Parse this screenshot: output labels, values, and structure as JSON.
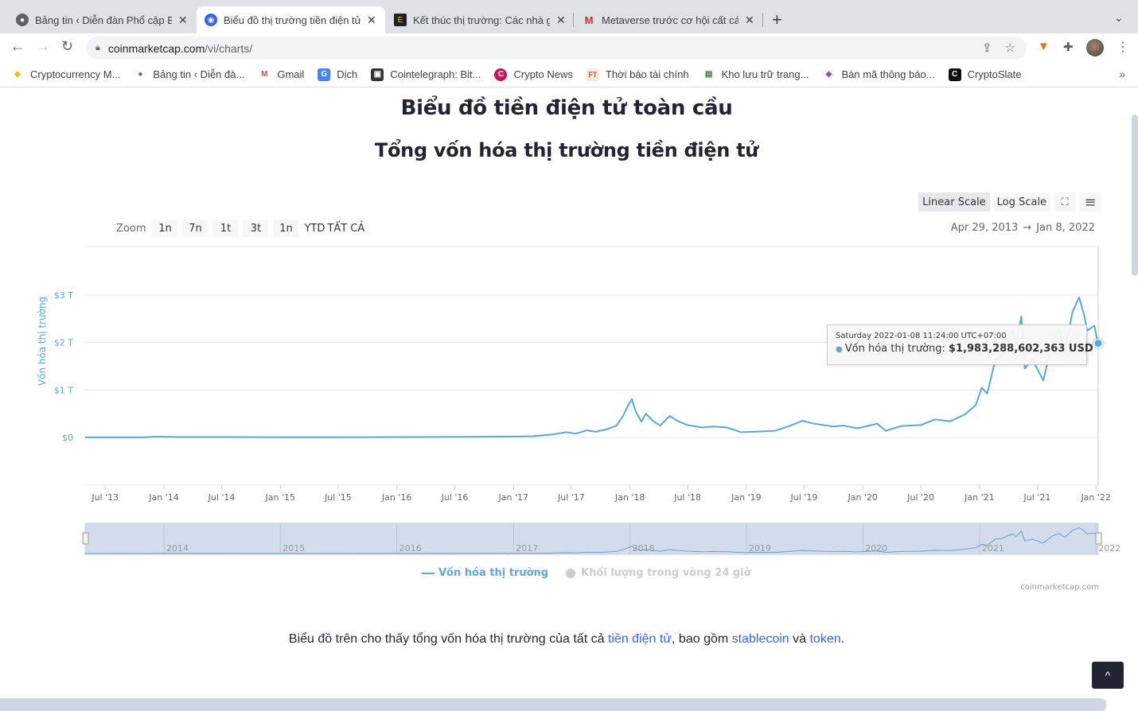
{
  "browser": {
    "tabs": [
      {
        "label": "Bảng tin ‹ Diễn đàn Phổ cập Bl",
        "icon": "globe-icon",
        "active": false
      },
      {
        "label": "Biểu đồ thị trường tiền điện tử t",
        "icon": "coinmarketcap-icon",
        "active": true
      },
      {
        "label": "Kết thúc thị trường: Các nhà gi",
        "icon": "site-icon",
        "active": false
      },
      {
        "label": "Metaverse trước cơ hội cất cán",
        "icon": "gmail-like-icon",
        "active": false
      }
    ],
    "close_glyph": "✕",
    "new_tab_glyph": "+",
    "url_domain": "coinmarketcap.com",
    "url_path": "/vi/charts/",
    "bookmarks": [
      {
        "label": "Cryptocurrency M...",
        "icon": "binance-icon",
        "glyph": "◆",
        "color": "#f0b90b"
      },
      {
        "label": "Bảng tin ‹ Diễn đà...",
        "icon": "globe-icon",
        "glyph": "●",
        "color": "#5f6368"
      },
      {
        "label": "Gmail",
        "icon": "gmail-icon",
        "glyph": "M",
        "color": "#ea4335"
      },
      {
        "label": "Dịch",
        "icon": "translate-icon",
        "glyph": "G",
        "color": "#4285f4"
      },
      {
        "label": "Cointelegraph: Bit...",
        "icon": "cointelegraph-icon",
        "glyph": "▣",
        "color": "#333333"
      },
      {
        "label": "Crypto News",
        "icon": "crypto-news-icon",
        "glyph": "C",
        "color": "#c2185b"
      },
      {
        "label": "Thời báo tài chính",
        "icon": "ft-icon",
        "glyph": "FT",
        "color": "#b05a3c"
      },
      {
        "label": "Kho lưu trữ trang...",
        "icon": "archive-icon",
        "glyph": "▤",
        "color": "#2e7d32"
      },
      {
        "label": "Bán mã thông báo...",
        "icon": "fox-icon",
        "glyph": "◈",
        "color": "#8e44ad"
      },
      {
        "label": "CryptoSlate",
        "icon": "cryptoslate-icon",
        "glyph": "C",
        "color": "#111111"
      }
    ],
    "more_glyph": "»"
  },
  "page": {
    "title": "Biểu đồ tiền điện tử toàn cầu",
    "subtitle": "Tổng vốn hóa thị trường tiền điện tử",
    "scale_buttons": [
      {
        "label": "Linear Scale",
        "active": true
      },
      {
        "label": "Log Scale",
        "active": false
      }
    ],
    "zoom_label": "Zoom",
    "zoom_buttons": [
      "1n",
      "7n",
      "1t",
      "3t",
      "1n",
      "YTD",
      "TẤT CẢ"
    ],
    "range_from": "Apr 29, 2013",
    "range_arrow": "→",
    "range_to": "Jan 8, 2022",
    "tooltip": {
      "date": "Saturday 2022-01-08 11:24:00 UTC+07:00",
      "series": "Vốn hóa thị trường:",
      "value": "$1,983,288,602,363 USD"
    },
    "legend": [
      {
        "label": "Vốn hóa thị trường",
        "color": "#5ba7d8",
        "enabled": true
      },
      {
        "label": "Khối lượng trong vòng 24 giờ",
        "color": "#cccccc",
        "enabled": false
      }
    ],
    "credit": "coinmarketcap.com",
    "description": {
      "before": "Biểu đồ trên cho thấy tổng vốn hóa thị trường của tất cả ",
      "link1": "tiền điện tử",
      "middle": ", bao gồm ",
      "link2": "stablecoin",
      "and": " và ",
      "link3": "token",
      "end": "."
    },
    "back_to_top_glyph": "^"
  },
  "chart_data": {
    "type": "line",
    "title": "Tổng vốn hóa thị trường tiền điện tử",
    "xlabel": "",
    "ylabel": "Vốn hóa thị trường",
    "y_unit": "trillion USD",
    "ylim": [
      0,
      3.3
    ],
    "yticks": [
      0,
      1,
      2,
      3
    ],
    "ytick_labels": [
      "$0",
      "$1 T",
      "$2 T",
      "$3 T"
    ],
    "x_range": [
      "2013-04-29",
      "2022-01-08"
    ],
    "xticks": [
      "2013-07-01",
      "2014-01-01",
      "2014-07-01",
      "2015-01-01",
      "2015-07-01",
      "2016-01-01",
      "2016-07-01",
      "2017-01-01",
      "2017-07-01",
      "2018-01-01",
      "2018-07-01",
      "2019-01-01",
      "2019-07-01",
      "2020-01-01",
      "2020-07-01",
      "2021-01-01",
      "2021-07-01",
      "2022-01-01"
    ],
    "xtick_labels": [
      "Jul '13",
      "Jan '14",
      "Jul '14",
      "Jan '15",
      "Jul '15",
      "Jan '16",
      "Jul '16",
      "Jan '17",
      "Jul '17",
      "Jan '18",
      "Jul '18",
      "Jan '19",
      "Jul '19",
      "Jan '20",
      "Jul '20",
      "Jan '21",
      "Jul '21",
      "Jan '22"
    ],
    "navigator_labels": [
      "2014",
      "2015",
      "2016",
      "2017",
      "2018",
      "2019",
      "2020",
      "2021",
      "2022"
    ],
    "grid": true,
    "legend_position": "bottom-center",
    "series": [
      {
        "name": "Vốn hóa thị trường",
        "color": "#5ba7d8",
        "points": [
          [
            "2013-04-29",
            0.0016
          ],
          [
            "2013-11-01",
            0.003
          ],
          [
            "2013-12-05",
            0.014
          ],
          [
            "2014-03-01",
            0.009
          ],
          [
            "2014-07-01",
            0.008
          ],
          [
            "2015-01-01",
            0.005
          ],
          [
            "2015-07-01",
            0.004
          ],
          [
            "2016-01-01",
            0.007
          ],
          [
            "2016-07-01",
            0.011
          ],
          [
            "2017-01-01",
            0.018
          ],
          [
            "2017-03-01",
            0.025
          ],
          [
            "2017-05-01",
            0.06
          ],
          [
            "2017-06-15",
            0.11
          ],
          [
            "2017-07-15",
            0.08
          ],
          [
            "2017-08-20",
            0.15
          ],
          [
            "2017-09-15",
            0.12
          ],
          [
            "2017-10-20",
            0.17
          ],
          [
            "2017-11-20",
            0.25
          ],
          [
            "2017-12-10",
            0.45
          ],
          [
            "2017-12-22",
            0.62
          ],
          [
            "2018-01-07",
            0.81
          ],
          [
            "2018-01-18",
            0.56
          ],
          [
            "2018-02-06",
            0.33
          ],
          [
            "2018-02-20",
            0.5
          ],
          [
            "2018-03-15",
            0.34
          ],
          [
            "2018-04-06",
            0.25
          ],
          [
            "2018-05-05",
            0.45
          ],
          [
            "2018-06-01",
            0.34
          ],
          [
            "2018-07-01",
            0.26
          ],
          [
            "2018-08-15",
            0.21
          ],
          [
            "2018-09-20",
            0.23
          ],
          [
            "2018-11-01",
            0.21
          ],
          [
            "2018-12-15",
            0.11
          ],
          [
            "2019-02-01",
            0.12
          ],
          [
            "2019-04-01",
            0.14
          ],
          [
            "2019-05-15",
            0.24
          ],
          [
            "2019-06-26",
            0.35
          ],
          [
            "2019-08-01",
            0.29
          ],
          [
            "2019-10-01",
            0.23
          ],
          [
            "2019-11-01",
            0.25
          ],
          [
            "2019-12-15",
            0.19
          ],
          [
            "2020-02-15",
            0.29
          ],
          [
            "2020-03-13",
            0.14
          ],
          [
            "2020-05-01",
            0.24
          ],
          [
            "2020-07-01",
            0.26
          ],
          [
            "2020-08-15",
            0.38
          ],
          [
            "2020-10-01",
            0.34
          ],
          [
            "2020-11-15",
            0.48
          ],
          [
            "2020-12-20",
            0.68
          ],
          [
            "2021-01-08",
            1.05
          ],
          [
            "2021-01-25",
            0.92
          ],
          [
            "2021-02-20",
            1.65
          ],
          [
            "2021-03-10",
            1.7
          ],
          [
            "2021-04-15",
            2.25
          ],
          [
            "2021-04-25",
            1.95
          ],
          [
            "2021-05-12",
            2.55
          ],
          [
            "2021-05-23",
            1.45
          ],
          [
            "2021-06-15",
            1.65
          ],
          [
            "2021-07-20",
            1.2
          ],
          [
            "2021-08-15",
            1.95
          ],
          [
            "2021-09-06",
            2.3
          ],
          [
            "2021-09-25",
            1.85
          ],
          [
            "2021-10-20",
            2.65
          ],
          [
            "2021-11-09",
            2.95
          ],
          [
            "2021-11-26",
            2.55
          ],
          [
            "2021-12-04",
            2.25
          ],
          [
            "2021-12-27",
            2.35
          ],
          [
            "2022-01-05",
            2.05
          ],
          [
            "2022-01-08",
            1.983
          ]
        ]
      }
    ],
    "highlighted_point": {
      "date": "2022-01-08",
      "value_usd": 1983288602363
    }
  }
}
